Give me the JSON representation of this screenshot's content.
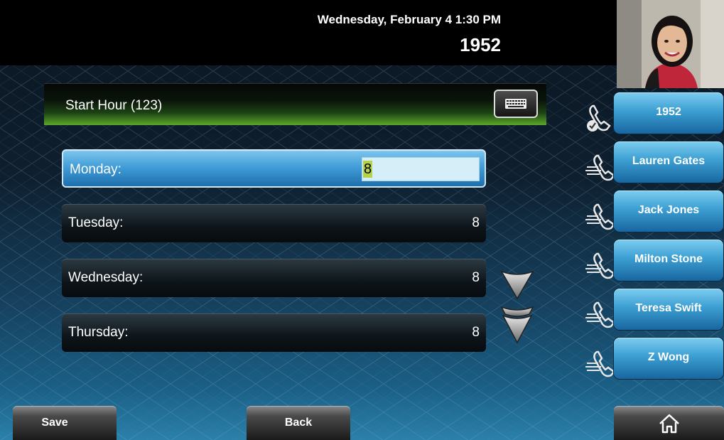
{
  "status_bar": {
    "datetime": "Wednesday, February 4  1:30 PM",
    "extension": "1952"
  },
  "header": {
    "title": "Start Hour (123)",
    "keyboard_icon": "keyboard-icon"
  },
  "rows": [
    {
      "label": "Monday:",
      "value": "8",
      "selected": true
    },
    {
      "label": "Tuesday:",
      "value": "8",
      "selected": false
    },
    {
      "label": "Wednesday:",
      "value": "8",
      "selected": false
    },
    {
      "label": "Thursday:",
      "value": "8",
      "selected": false
    }
  ],
  "scroll": {
    "down_icon": "chevron-down-icon",
    "page_down_icon": "double-chevron-down-icon"
  },
  "lines": [
    {
      "label": "1952",
      "icon": "handset-registered-icon"
    },
    {
      "label": "Lauren Gates",
      "icon": "handset-speeddial-icon"
    },
    {
      "label": "Jack Jones",
      "icon": "handset-speeddial-icon"
    },
    {
      "label": "Milton Stone",
      "icon": "handset-speeddial-icon"
    },
    {
      "label": "Teresa Swift",
      "icon": "handset-speeddial-icon"
    },
    {
      "label": "Z Wong",
      "icon": "handset-speeddial-icon"
    }
  ],
  "softkeys": {
    "save": "Save",
    "back": "Back",
    "home_icon": "home-icon"
  },
  "colors": {
    "accent_blue": "#3c9fd2",
    "header_green": "#5ca828",
    "highlight_yellow": "#b5d24a"
  }
}
